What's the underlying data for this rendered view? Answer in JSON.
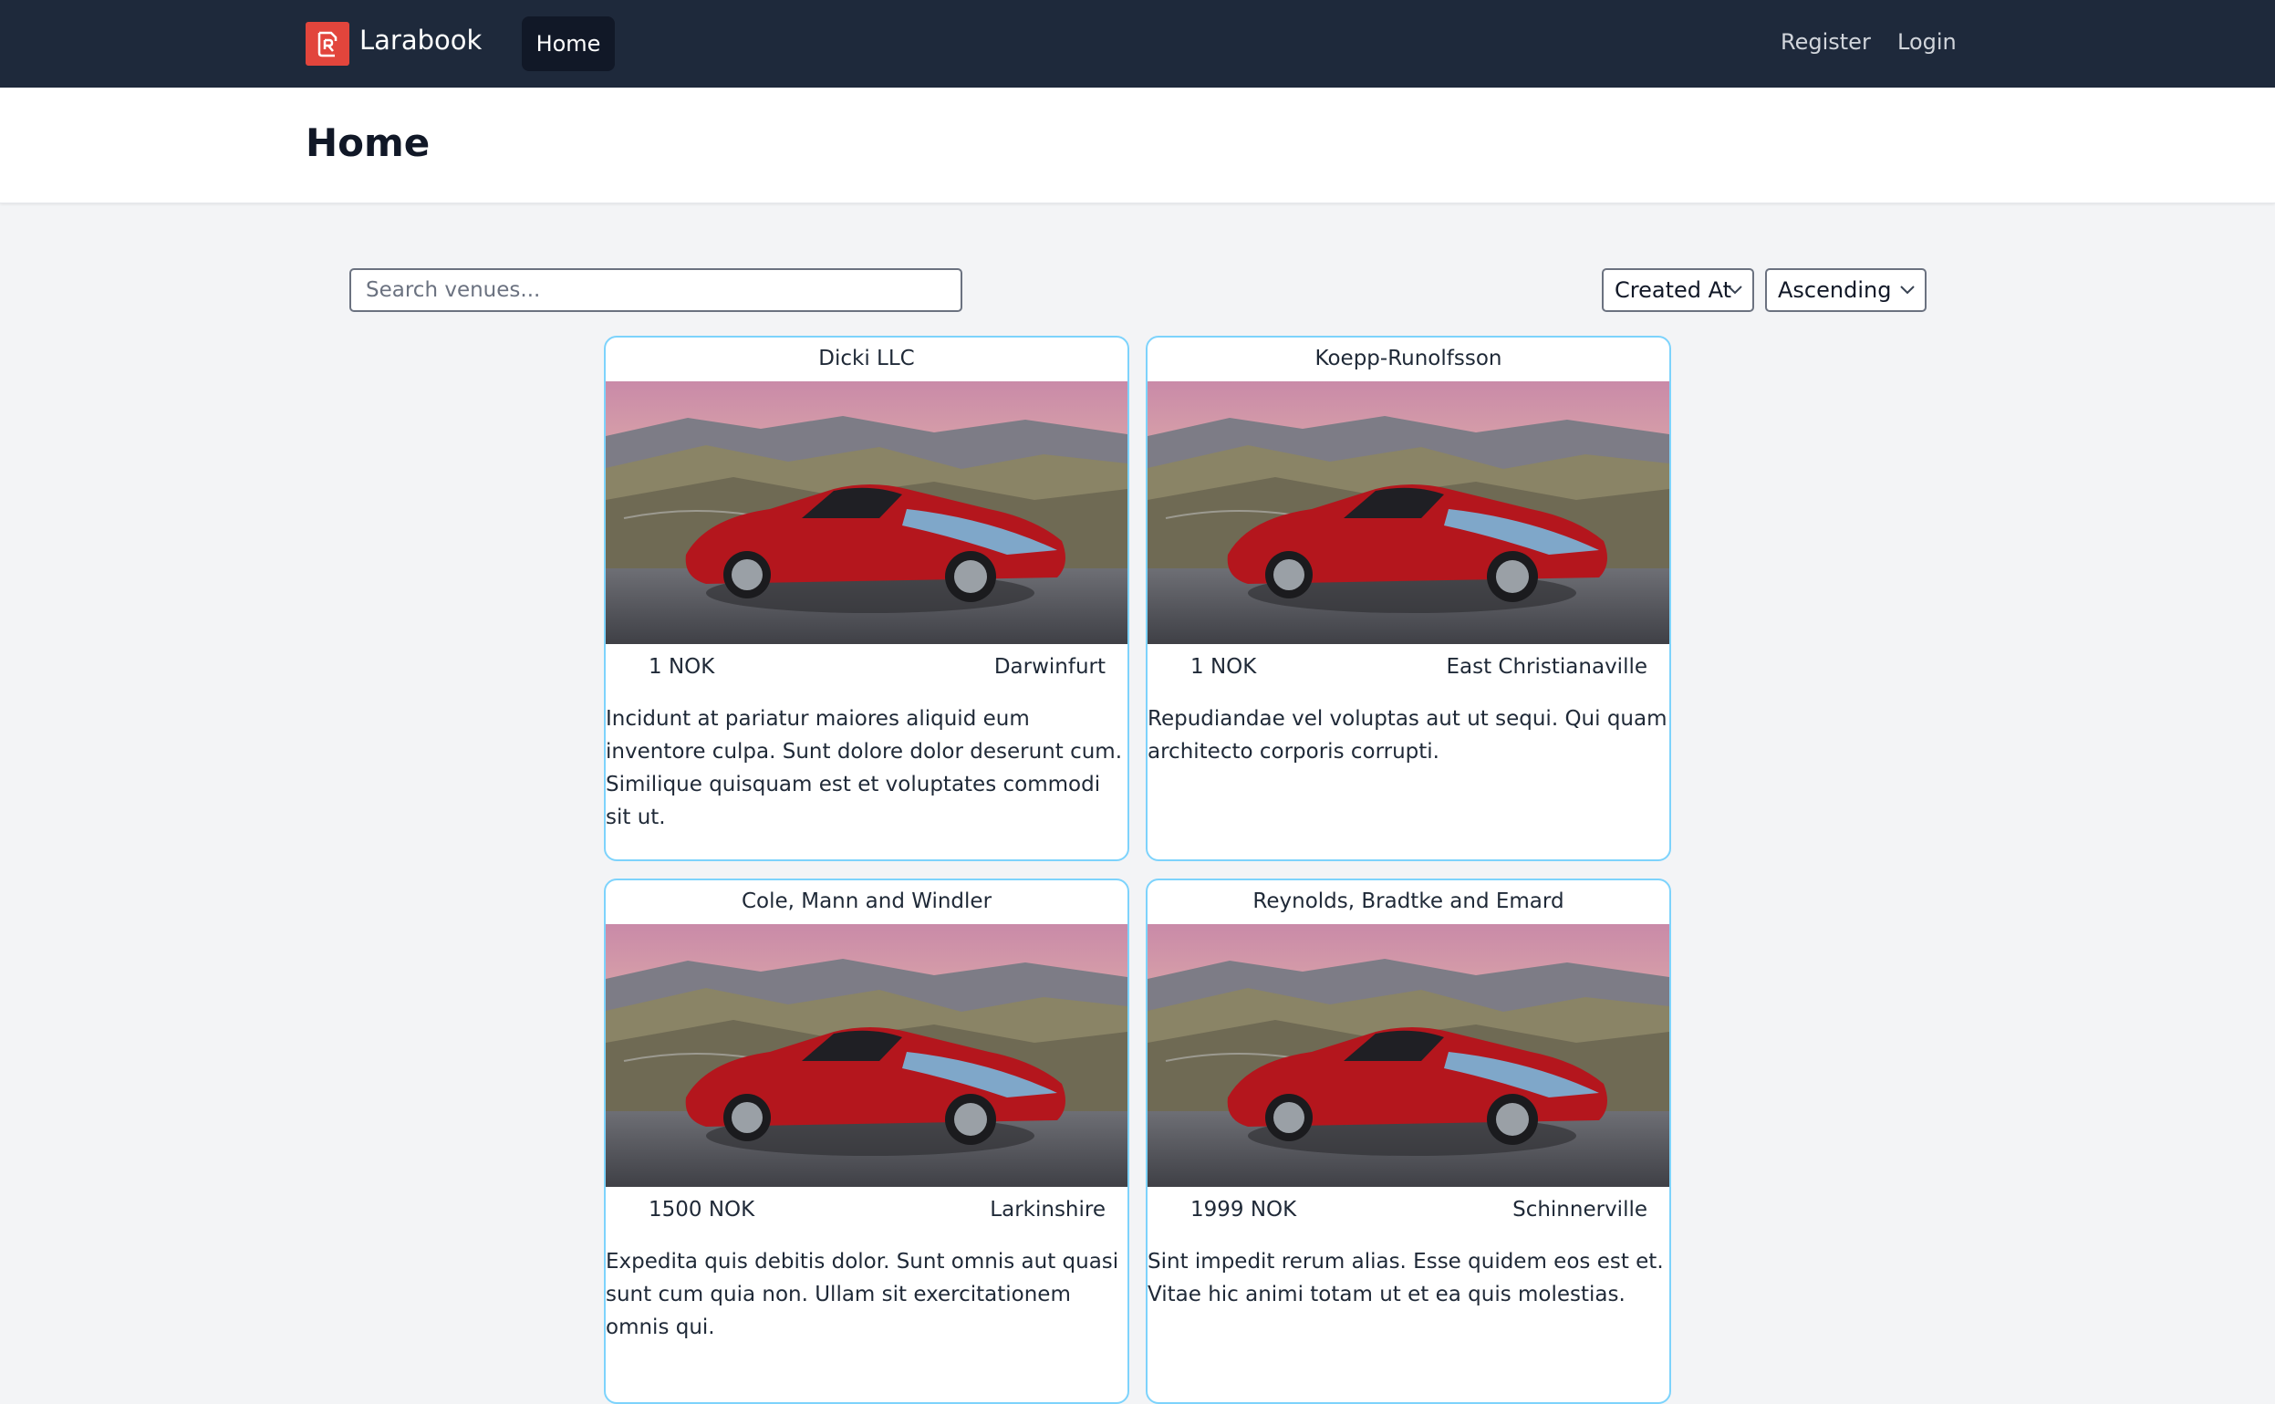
{
  "nav": {
    "brand": "Larabook",
    "home": "Home",
    "register": "Register",
    "login": "Login",
    "brand_color": "#e2453c",
    "background_color": "#1e293b"
  },
  "header": {
    "title": "Home"
  },
  "controls": {
    "search_placeholder": "Search venues...",
    "sort_by": "Created At",
    "sort_order": "Ascending"
  },
  "venues": [
    {
      "name": "Dicki LLC",
      "price": "1 NOK",
      "city": "Darwinfurt",
      "description": "Incidunt at pariatur maiores aliquid eum inventore culpa. Sunt dolore dolor deserunt cum. Similique quisquam est et voluptates commodi sit ut."
    },
    {
      "name": "Koepp-Runolfsson",
      "price": "1 NOK",
      "city": "East Christianaville",
      "description": "Repudiandae vel voluptas aut ut sequi. Qui quam architecto corporis corrupti."
    },
    {
      "name": "Cole, Mann and Windler",
      "price": "1500 NOK",
      "city": "Larkinshire",
      "description": "Expedita quis debitis dolor. Sunt omnis aut quasi sunt cum quia non. Ullam sit exercitationem omnis qui."
    },
    {
      "name": "Reynolds, Bradtke and Emard",
      "price": "1999 NOK",
      "city": "Schinnerville",
      "description": "Sint impedit rerum alias. Esse quidem eos est et. Vitae hic animi totam ut et ea quis molestias."
    }
  ],
  "card_border_color": "#7dd3fc"
}
